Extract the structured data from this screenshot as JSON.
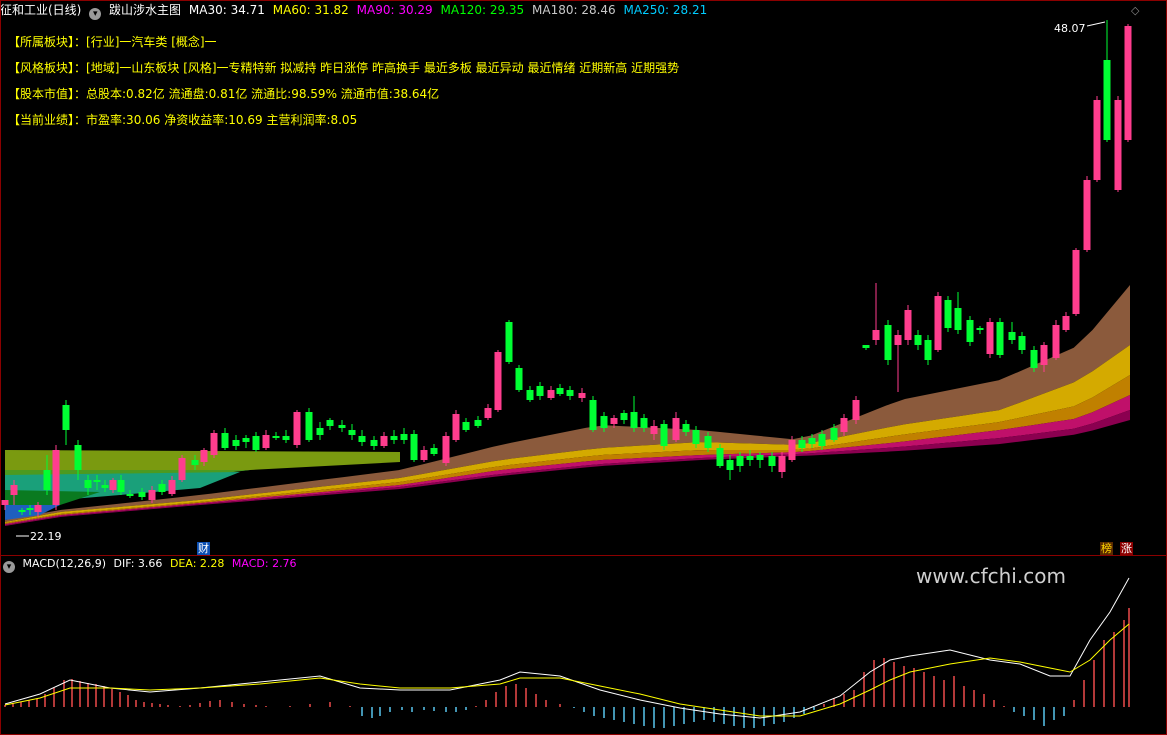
{
  "header": {
    "stock": "征和工业(日线)",
    "indicator": "跋山涉水主图",
    "ma": [
      {
        "label": "MA30: 34.71",
        "color": "#ffffff"
      },
      {
        "label": "MA60: 31.82",
        "color": "#ffff00"
      },
      {
        "label": "MA90: 30.29",
        "color": "#ff00ff"
      },
      {
        "label": "MA120: 29.35",
        "color": "#00ff00"
      },
      {
        "label": "MA180: 28.46",
        "color": "#c8c8c8"
      },
      {
        "label": "MA250: 28.21",
        "color": "#00ccff"
      }
    ]
  },
  "info": [
    {
      "key": "【所属板块】：",
      "val": "[行业]一汽车类 [概念]一"
    },
    {
      "key": "【风格板块】：",
      "val": "[地域]一山东板块 [风格]一专精特新 拟减持 昨日涨停 昨高换手 最近多板 最近异动 最近情绪 近期新高 近期强势"
    },
    {
      "key": "【股本市值】：",
      "val": "总股本:0.82亿 流通盘:0.81亿 流通比:98.59% 流通市值:38.64亿"
    },
    {
      "key": "【当前业绩】：",
      "val": "市盈率:30.06 净资收益率:10.69 主营利润率:8.05"
    }
  ],
  "price_labels": {
    "high": "48.07",
    "low": "22.19"
  },
  "tags": {
    "cai": "财",
    "bang": "榜",
    "zhang": "涨"
  },
  "macd": {
    "title": "MACD(12,26,9)",
    "dif": "DIF: 3.66",
    "dea": "DEA: 2.28",
    "macd": "MACD: 2.76"
  },
  "watermark": "www.cfchi.com",
  "colors": {
    "up": "#ff3d8e",
    "down": "#00ff33",
    "dif": "#ffffff",
    "dea": "#ffff00",
    "bar_pos": "#ff5050",
    "bar_neg": "#5fd3ff"
  }
}
